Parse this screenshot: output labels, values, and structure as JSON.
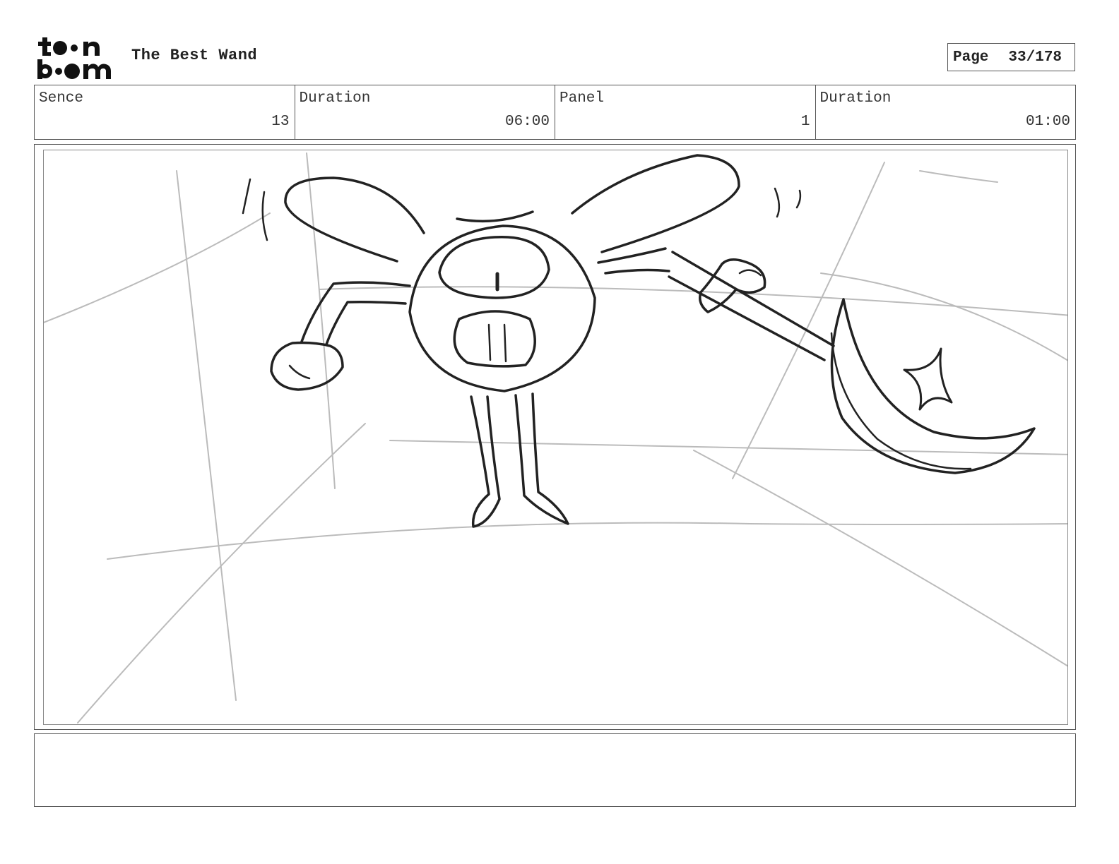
{
  "header": {
    "logo_text": "toon boom",
    "title": "The Best Wand",
    "page_label": "Page",
    "page_number": "33/178"
  },
  "info": [
    {
      "label": "Sence",
      "value": "13"
    },
    {
      "label": "Duration",
      "value": "06:00"
    },
    {
      "label": "Panel",
      "value": "1"
    },
    {
      "label": "Duration",
      "value": "01:00"
    }
  ],
  "panel": {
    "sketch_subject": "one-eyed winged creature holding a crescent-moon wand"
  },
  "notes": {
    "text": ""
  }
}
